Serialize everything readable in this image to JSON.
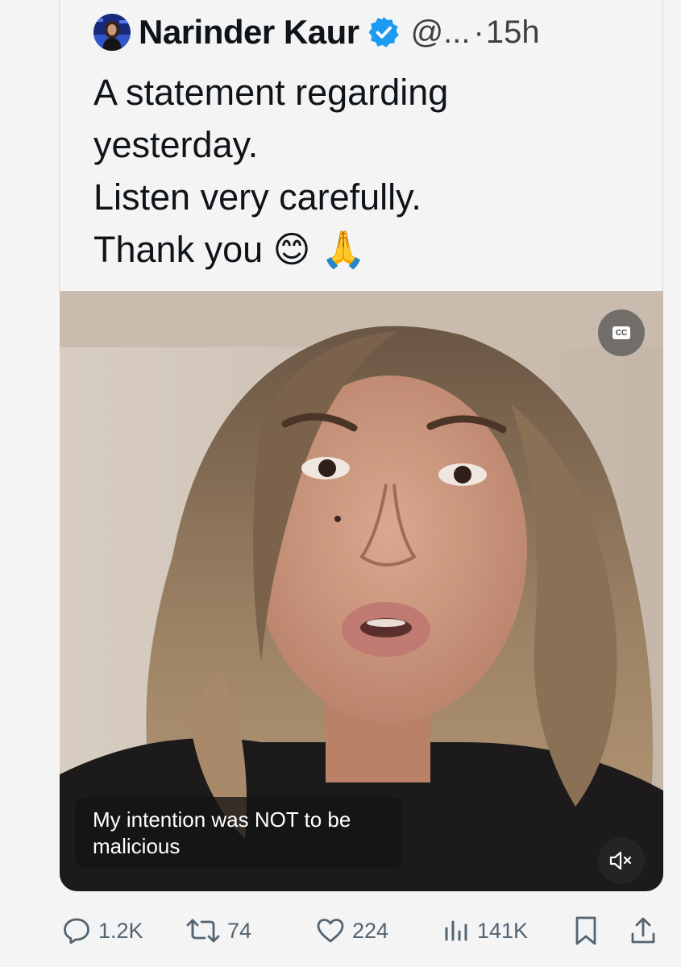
{
  "tweet": {
    "author_name": "Narinder Kaur",
    "handle": "@...",
    "separator": "·",
    "time": "15h",
    "text_lines": [
      "A statement regarding",
      "yesterday.",
      "Listen very carefully.",
      "Thank you 😊 🙏"
    ]
  },
  "media": {
    "cc_label": "CC",
    "caption": "My intention was NOT to be malicious"
  },
  "actions": {
    "replies": "1.2K",
    "reposts": "74",
    "likes": "224",
    "views": "141K"
  },
  "icons": {
    "verified": "verified-badge-icon",
    "reply": "reply-icon",
    "repost": "repost-icon",
    "like": "heart-icon",
    "views": "views-icon",
    "bookmark": "bookmark-icon",
    "share": "share-icon",
    "mute": "muted-speaker-icon"
  },
  "colors": {
    "verified_blue": "#1d9bf0",
    "action_gray": "#536471"
  }
}
